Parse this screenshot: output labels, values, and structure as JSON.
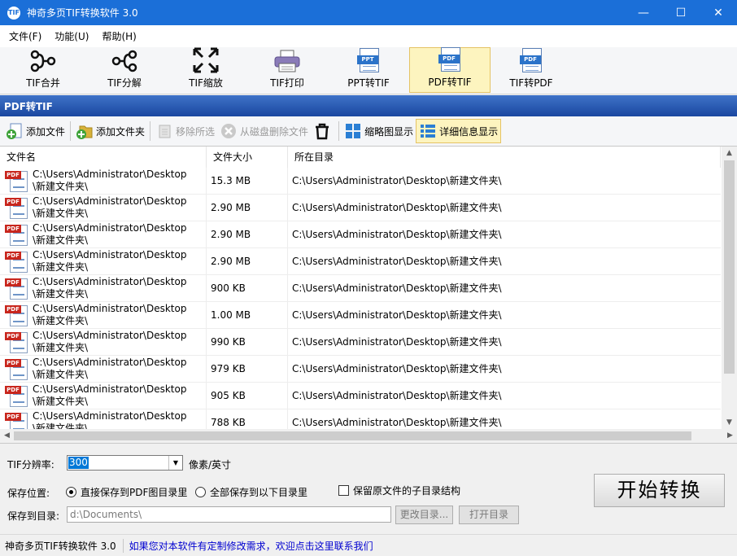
{
  "window": {
    "app_icon_text": "TIF",
    "title": "神奇多页TIF转换软件 3.0",
    "minimize": "—",
    "maximize": "☐",
    "close": "✕"
  },
  "menu": [
    "文件(F)",
    "功能(U)",
    "帮助(H)"
  ],
  "toolbar": [
    {
      "label": "TIF合并",
      "icon": "merge-icon"
    },
    {
      "label": "TIF分解",
      "icon": "split-icon"
    },
    {
      "label": "TIF缩放",
      "icon": "scale-icon"
    },
    {
      "label": "TIF打印",
      "icon": "printer-icon"
    },
    {
      "label": "PPT转TIF",
      "icon": "ppt-doc-icon",
      "tag": "PPT"
    },
    {
      "label": "PDF转TIF",
      "icon": "pdf-doc-icon",
      "tag": "PDF",
      "active": true
    },
    {
      "label": "TIF转PDF",
      "icon": "pdf-doc-icon",
      "tag": "PDF"
    }
  ],
  "section_title": "PDF转TIF",
  "actions": {
    "add_file": "添加文件",
    "add_folder": "添加文件夹",
    "remove_selected": "移除所选",
    "delete_from_disk": "从磁盘删除文件",
    "thumbnail_view": "缩略图显示",
    "detail_view": "详细信息显示"
  },
  "table": {
    "headers": [
      "文件名",
      "文件大小",
      "所在目录"
    ],
    "file_tag": "PDF",
    "rows": [
      {
        "name": "C:\\Users\\Administrator\\Desktop\\新建文件夹\\",
        "size": "15.3 MB",
        "dir": "C:\\Users\\Administrator\\Desktop\\新建文件夹\\"
      },
      {
        "name": "C:\\Users\\Administrator\\Desktop\\新建文件夹\\",
        "size": "2.90 MB",
        "dir": "C:\\Users\\Administrator\\Desktop\\新建文件夹\\"
      },
      {
        "name": "C:\\Users\\Administrator\\Desktop\\新建文件夹\\",
        "size": "2.90 MB",
        "dir": "C:\\Users\\Administrator\\Desktop\\新建文件夹\\"
      },
      {
        "name": "C:\\Users\\Administrator\\Desktop\\新建文件夹\\",
        "size": "2.90 MB",
        "dir": "C:\\Users\\Administrator\\Desktop\\新建文件夹\\"
      },
      {
        "name": "C:\\Users\\Administrator\\Desktop\\新建文件夹\\",
        "size": "900 KB",
        "dir": "C:\\Users\\Administrator\\Desktop\\新建文件夹\\"
      },
      {
        "name": "C:\\Users\\Administrator\\Desktop\\新建文件夹\\",
        "size": "1.00 MB",
        "dir": "C:\\Users\\Administrator\\Desktop\\新建文件夹\\"
      },
      {
        "name": "C:\\Users\\Administrator\\Desktop\\新建文件夹\\",
        "size": "990 KB",
        "dir": "C:\\Users\\Administrator\\Desktop\\新建文件夹\\"
      },
      {
        "name": "C:\\Users\\Administrator\\Desktop\\新建文件夹\\",
        "size": "979 KB",
        "dir": "C:\\Users\\Administrator\\Desktop\\新建文件夹\\"
      },
      {
        "name": "C:\\Users\\Administrator\\Desktop\\新建文件夹\\",
        "size": "905 KB",
        "dir": "C:\\Users\\Administrator\\Desktop\\新建文件夹\\"
      },
      {
        "name": "C:\\Users\\Administrator\\Desktop\\新建文件夹\\",
        "size": "788 KB",
        "dir": "C:\\Users\\Administrator\\Desktop\\新建文件夹\\"
      }
    ]
  },
  "settings": {
    "resolution_label": "TIF分辨率:",
    "resolution_value": "300",
    "resolution_unit": "像素/英寸",
    "save_location_label": "保存位置:",
    "option_same_dir": "直接保存到PDF图目录里",
    "option_same_dir_selected": true,
    "option_below_dir": "全部保存到以下目录里",
    "keep_subdir": "保留原文件的子目录结构",
    "keep_subdir_checked": false,
    "save_dir_label": "保存到目录:",
    "save_dir_value": "d:\\Documents\\",
    "change_dir_button": "更改目录...",
    "open_dir_button": "打开目录",
    "start_button": "开始转换"
  },
  "status": {
    "app_name": "神奇多页TIF转换软件 3.0",
    "message": "如果您对本软件有定制修改需求，欢迎点击这里联系我们"
  }
}
